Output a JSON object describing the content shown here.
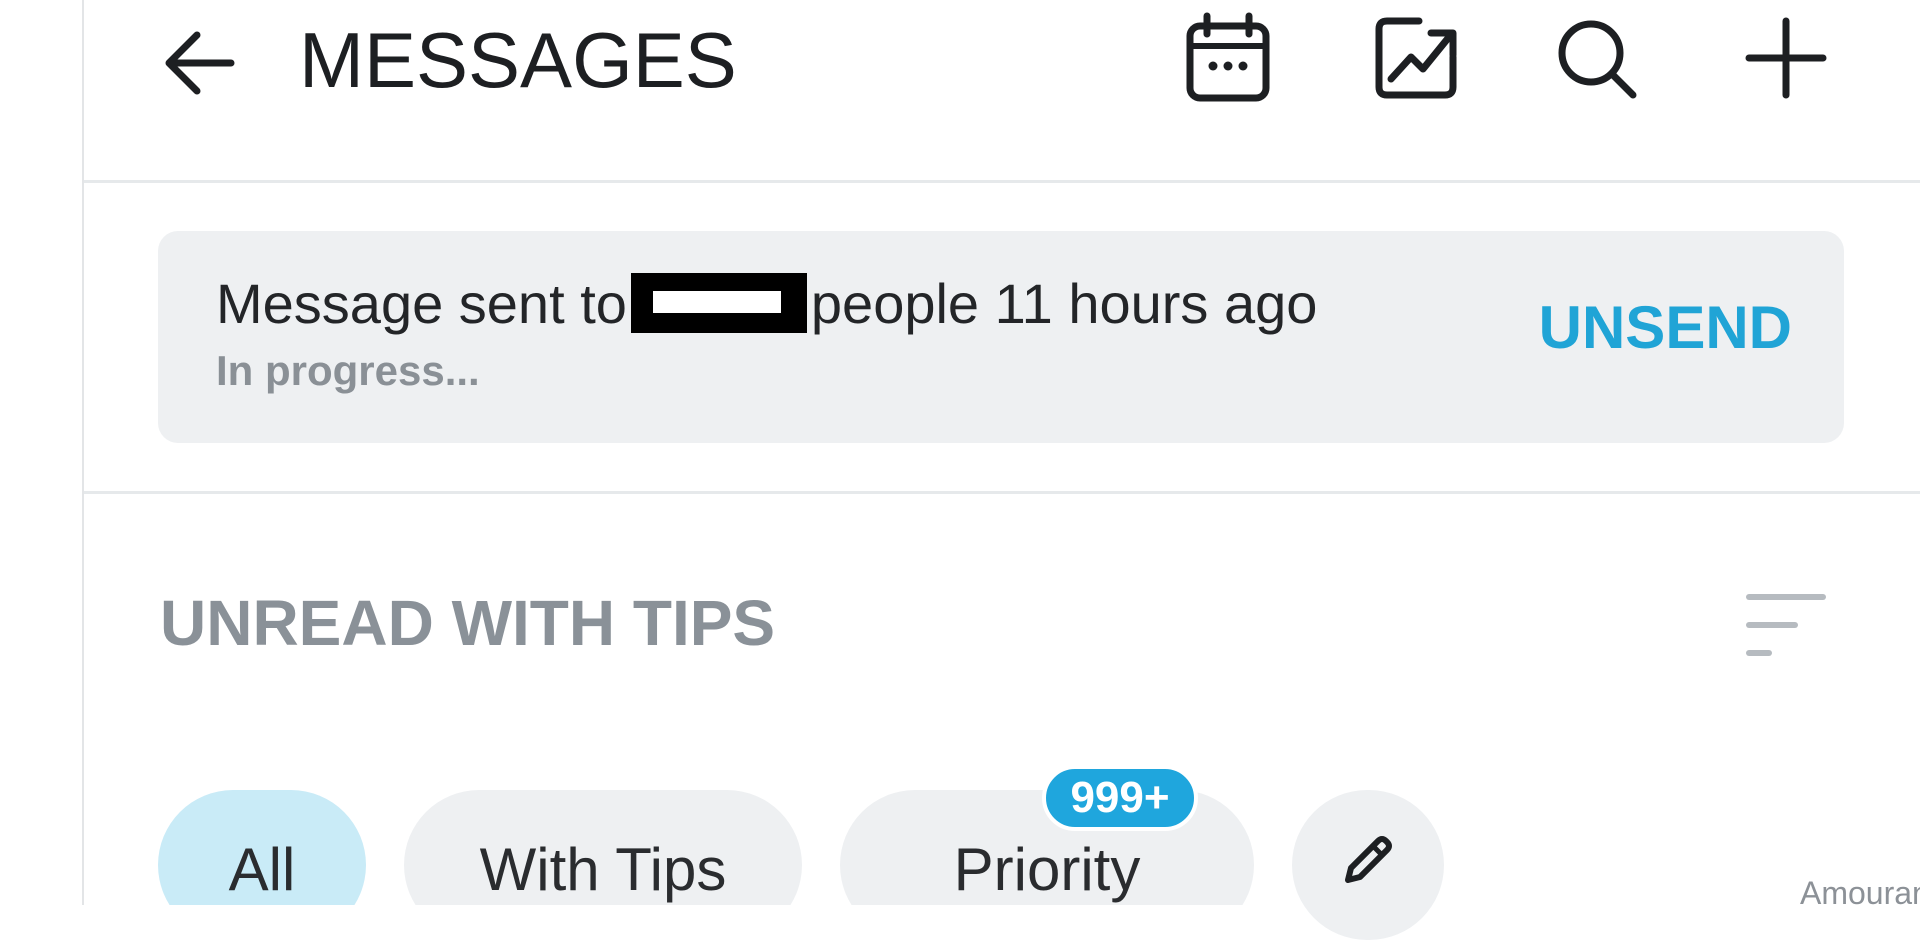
{
  "header": {
    "title": "MESSAGES",
    "icons": [
      "back-arrow-icon",
      "calendar-icon",
      "chart-icon",
      "search-icon",
      "plus-icon"
    ]
  },
  "notice": {
    "text_before": "Message sent to",
    "text_after": "people 11 hours ago",
    "status": "In progress...",
    "action_label": "UNSEND"
  },
  "list": {
    "heading": "UNREAD WITH TIPS"
  },
  "filters": {
    "chips": [
      {
        "label": "All",
        "active": true
      },
      {
        "label": "With Tips",
        "active": false
      },
      {
        "label": "Priority",
        "active": false
      }
    ],
    "priority_badge": "999+"
  },
  "watermark": "Amouranth",
  "colors": {
    "accent": "#20a4d6",
    "badge": "#1fa6dd",
    "active_chip": "#c9ebf7",
    "card_bg": "#eef0f2",
    "muted_text": "#8a9198"
  }
}
